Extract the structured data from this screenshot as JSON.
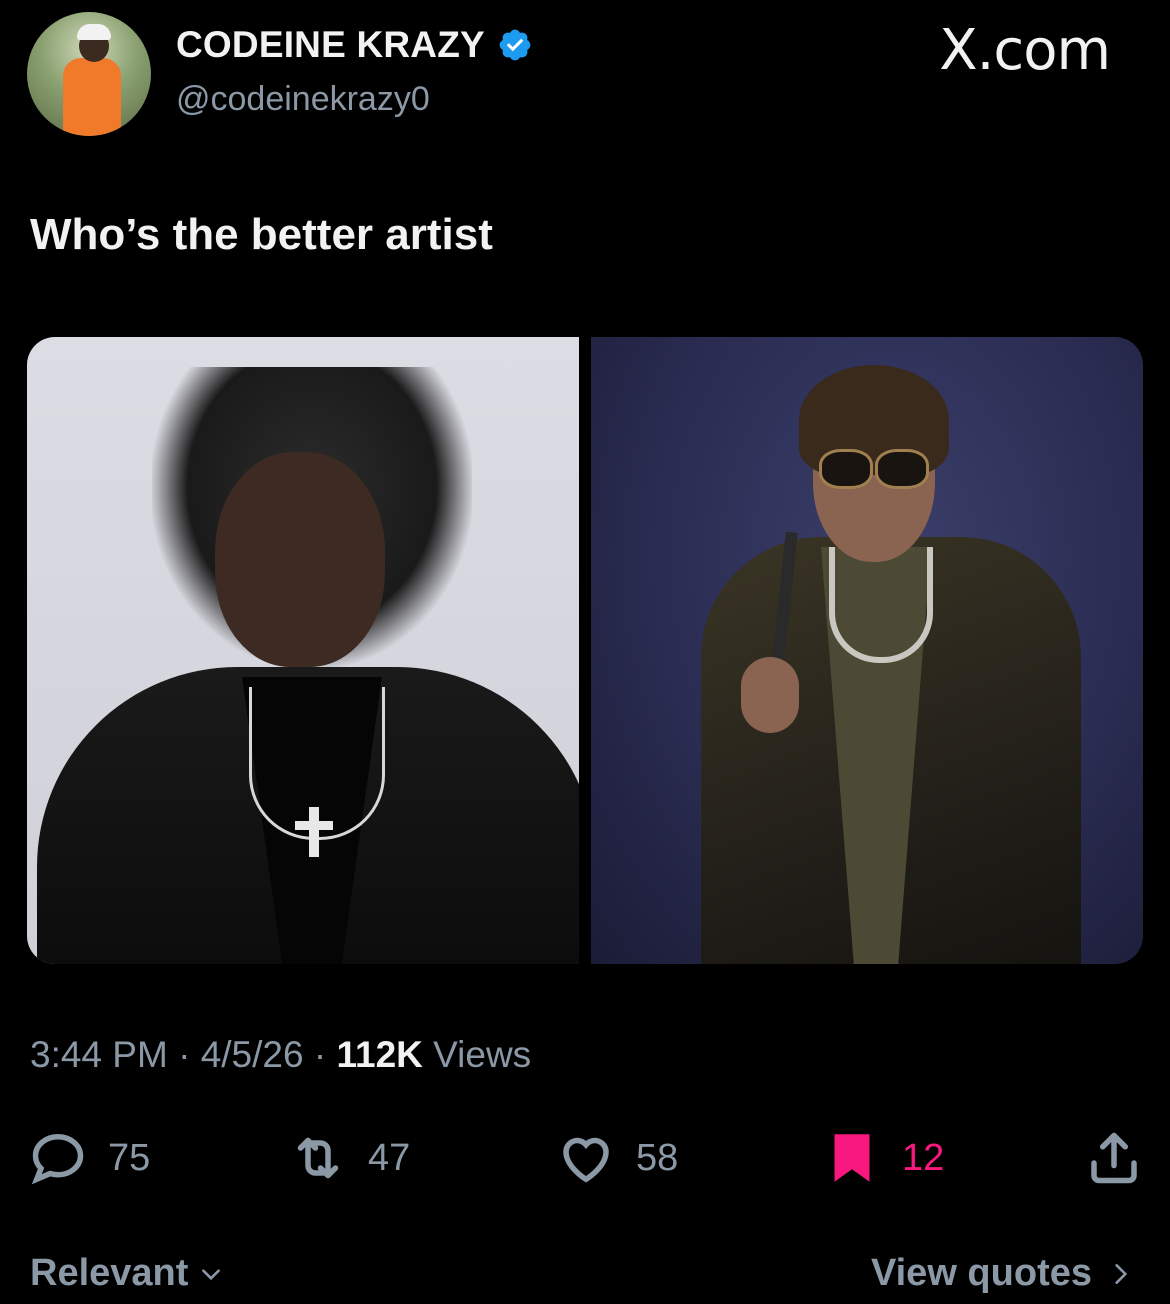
{
  "header": {
    "display_name": "CODEINE KRAZY",
    "handle": "@codeinekrazy0",
    "site": "X.com",
    "verified_color": "#1d9bf0"
  },
  "tweet": {
    "text": "Who’s the better artist",
    "images": [
      "artist-portrait-left",
      "artist-portrait-right"
    ]
  },
  "meta": {
    "time": "3:44 PM",
    "sep1": "·",
    "date": "4/5/26",
    "sep2": "·",
    "views_count": "112K",
    "views_label": "Views"
  },
  "actions": {
    "reply_count": "75",
    "repost_count": "47",
    "like_count": "58",
    "bookmark_count": "12",
    "bookmark_color": "#f91880"
  },
  "footer": {
    "sort_label": "Relevant",
    "view_quotes_label": "View quotes"
  }
}
